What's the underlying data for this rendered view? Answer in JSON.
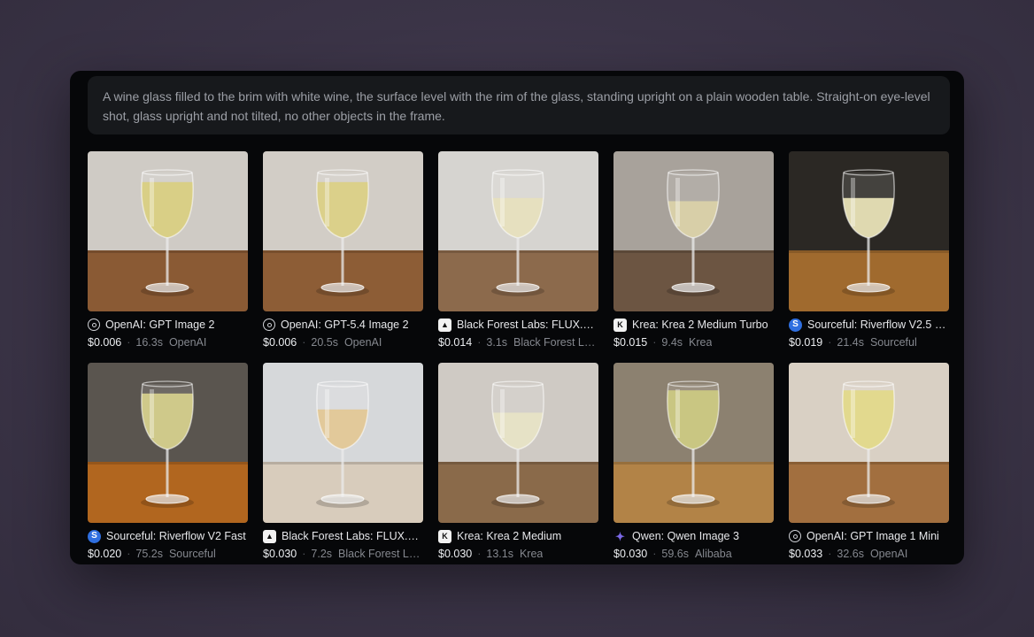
{
  "prompt": "A wine glass filled to the brim with white wine, the surface level with the rim of the glass, standing upright on a plain wooden table. Straight-on eye-level shot, glass upright and not tilted, no other objects in the frame.",
  "results": [
    {
      "model": "OpenAI: GPT Image 2",
      "price": "$0.006",
      "time": "16.3s",
      "provider": "OpenAI",
      "icon": "openai-icon",
      "wall": "#cfcbc5",
      "table": "#8a5a34",
      "wine": "#d9cf86",
      "fill": 0.85
    },
    {
      "model": "OpenAI: GPT-5.4 Image 2",
      "price": "$0.006",
      "time": "20.5s",
      "provider": "OpenAI",
      "icon": "openai-icon",
      "wall": "#d2cdc6",
      "table": "#8d5d36",
      "wine": "#dbd08a",
      "fill": 0.85
    },
    {
      "model": "Black Forest Labs: FLUX.2 ...",
      "price": "$0.014",
      "time": "3.1s",
      "provider": "Black Forest La...",
      "icon": "bfl-icon",
      "wall": "#d6d4d0",
      "table": "#8c6a4c",
      "wine": "#e6e0bf",
      "fill": 0.6
    },
    {
      "model": "Krea: Krea 2 Medium Turbo",
      "price": "$0.015",
      "time": "9.4s",
      "provider": "Krea",
      "icon": "krea-icon",
      "wall": "#a8a29b",
      "table": "#6c5542",
      "wine": "#d8cfa8",
      "fill": 0.55
    },
    {
      "model": "Sourceful: Riverflow V2.5 F...",
      "price": "$0.019",
      "time": "21.4s",
      "provider": "Sourceful",
      "icon": "sourceful-icon",
      "wall": "#2b2824",
      "table": "#a06a2e",
      "wine": "#dfd9b0",
      "fill": 0.6
    },
    {
      "model": "Sourceful: Riverflow V2 Fast",
      "price": "$0.020",
      "time": "75.2s",
      "provider": "Sourceful",
      "icon": "sourceful-icon",
      "wall": "#5a554f",
      "table": "#b1661f",
      "wine": "#cfc98a",
      "fill": 0.85
    },
    {
      "model": "Black Forest Labs: FLUX.2 ...",
      "price": "$0.030",
      "time": "7.2s",
      "provider": "Black Forest La...",
      "icon": "bfl-icon",
      "wall": "#d6d8da",
      "table": "#d8ccbc",
      "wine": "#e2c99a",
      "fill": 0.6
    },
    {
      "model": "Krea: Krea 2 Medium",
      "price": "$0.030",
      "time": "13.1s",
      "provider": "Krea",
      "icon": "krea-icon",
      "wall": "#cfcac4",
      "table": "#8a6a4a",
      "wine": "#e6e2c6",
      "fill": 0.55
    },
    {
      "model": "Qwen: Qwen Image 3",
      "price": "$0.030",
      "time": "59.6s",
      "provider": "Alibaba",
      "icon": "qwen-icon",
      "wall": "#8c8170",
      "table": "#b28347",
      "wine": "#c9c682",
      "fill": 0.9
    },
    {
      "model": "OpenAI: GPT Image 1 Mini",
      "price": "$0.033",
      "time": "32.6s",
      "provider": "OpenAI",
      "icon": "openai-icon",
      "wall": "#d9d0c4",
      "table": "#a26f3f",
      "wine": "#e2d98e",
      "fill": 0.9
    }
  ]
}
